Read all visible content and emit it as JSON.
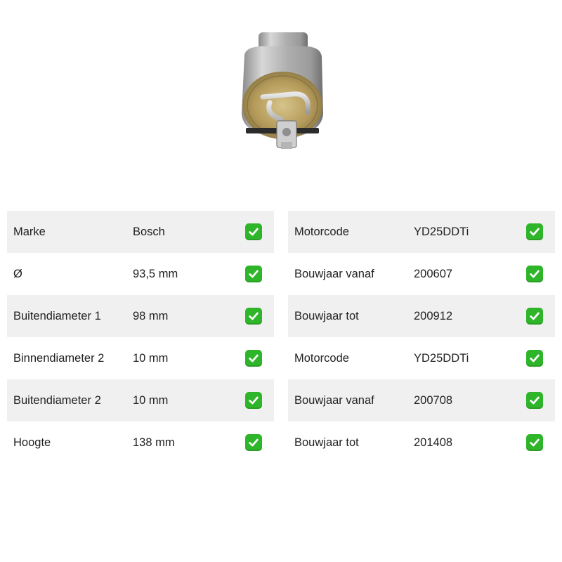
{
  "product": {
    "image_icon": "fuel-filter-image"
  },
  "colors": {
    "row_shade": "#f0f0f0",
    "check_green": "#2fb52a"
  },
  "left_specs": [
    {
      "label": "Marke",
      "value": "Bosch",
      "icon": "check-icon"
    },
    {
      "label": "Ø",
      "value": "93,5 mm",
      "icon": "check-icon"
    },
    {
      "label": "Buitendiameter 1",
      "value": "98 mm",
      "icon": "check-icon"
    },
    {
      "label": "Binnendiameter 2",
      "value": "10 mm",
      "icon": "check-icon"
    },
    {
      "label": "Buitendiameter 2",
      "value": "10 mm",
      "icon": "check-icon"
    },
    {
      "label": "Hoogte",
      "value": "138 mm",
      "icon": "check-icon"
    }
  ],
  "right_specs": [
    {
      "label": "Motorcode",
      "value": "YD25DDTi",
      "icon": "check-icon"
    },
    {
      "label": "Bouwjaar vanaf",
      "value": "200607",
      "icon": "check-icon"
    },
    {
      "label": "Bouwjaar tot",
      "value": "200912",
      "icon": "check-icon"
    },
    {
      "label": "Motorcode",
      "value": "YD25DDTi",
      "icon": "check-icon"
    },
    {
      "label": "Bouwjaar vanaf",
      "value": "200708",
      "icon": "check-icon"
    },
    {
      "label": "Bouwjaar tot",
      "value": "201408",
      "icon": "check-icon"
    }
  ]
}
